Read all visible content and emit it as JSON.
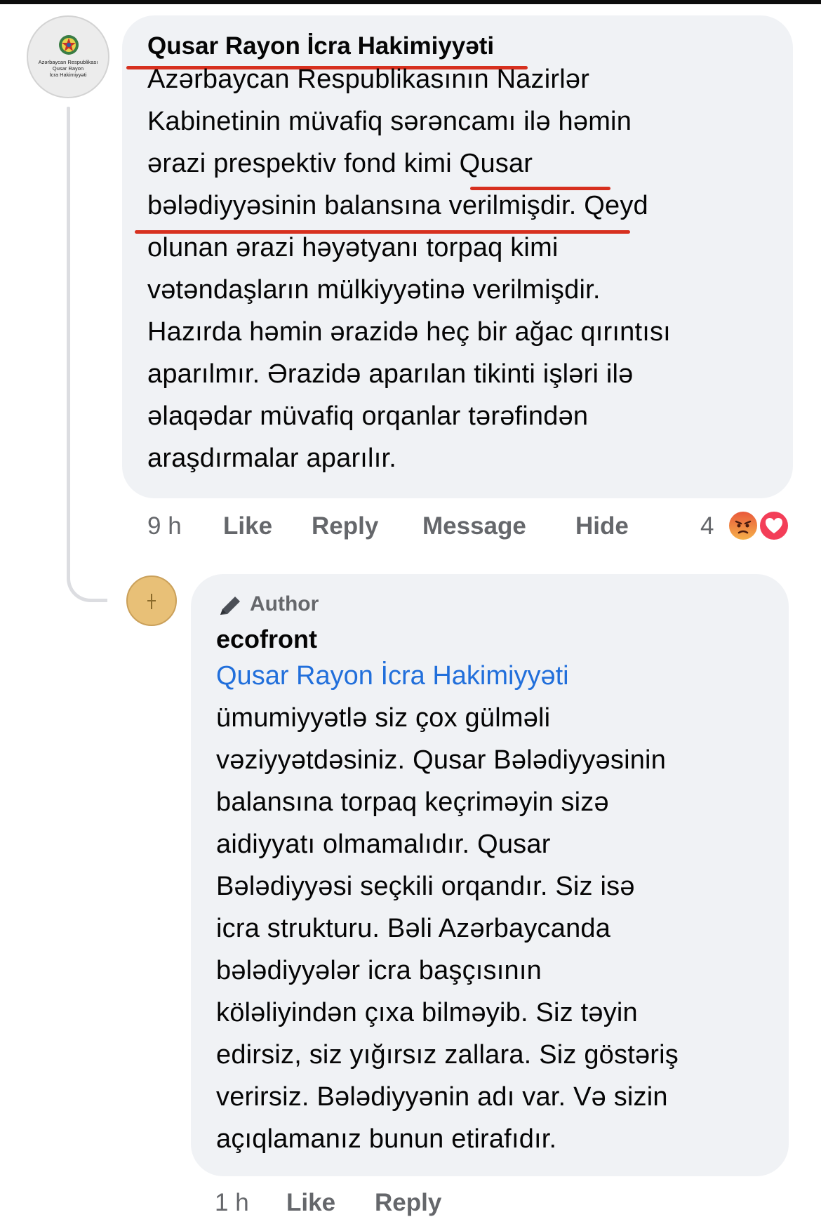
{
  "comment1": {
    "author": "Qusar Rayon İcra Hakimiyyəti",
    "avatar_lines": [
      "Azərbaycan Respublikası",
      "Qusar Rayon",
      "İcra Hakimiyyəti"
    ],
    "avatar_icon": "emblem-icon",
    "text_lines": [
      "Azərbaycan Respublikasının Nazirlər",
      "Kabinetinin müvafiq sərəncamı ilə həmin",
      "ərazi prespektiv fond kimi Qusar",
      "bələdiyyəsinin balansına verilmişdir. Qeyd",
      "olunan ərazi həyətyanı torpaq kimi",
      "vətəndaşların mülkiyyətinə verilmişdir.",
      "Hazırda həmin ərazidə heç bir ağac qırıntısı",
      "aparılmır. Ərazidə aparılan tikinti işləri ilə",
      "əlaqədar müvafiq orqanlar tərəfindən",
      "araşdırmalar aparılır."
    ],
    "actions": {
      "time": "9 h",
      "like": "Like",
      "reply": "Reply",
      "message": "Message",
      "hide": "Hide"
    },
    "reactions": {
      "count": "4",
      "icons": [
        "angry-reaction-icon",
        "love-reaction-icon"
      ],
      "colors": {
        "angry": "#e9593b",
        "love": "#f33e58"
      }
    },
    "annotation_color": "#d7301f"
  },
  "comment2": {
    "badge": "Author",
    "badge_icon": "pencil-icon",
    "author": "ecofront",
    "mention": "Qusar Rayon İcra Hakimiyyəti",
    "mention_color": "#216fdb",
    "text_lines": [
      "ümumiyyətlə siz çox gülməli",
      "vəziyyətdəsiniz. Qusar Bələdiyyəsinin",
      "balansına torpaq keçriməyin sizə",
      "aidiyyatı olmamalıdır. Qusar",
      "Bələdiyyəsi seçkili orqandır. Siz isə",
      "icra strukturu. Bəli Azərbaycanda",
      "bələdiyyələr icra başçısının",
      "köləliyindən çıxa bilməyib. Siz təyin",
      "edirsiz, siz yığırsız zallara. Siz göstəriş",
      "verirsiz. Bələdiyyənin adı var. Və sizin",
      "açıqlamanız bunun etirafıdır."
    ],
    "actions": {
      "time": "1 h",
      "like": "Like",
      "reply": "Reply"
    }
  }
}
